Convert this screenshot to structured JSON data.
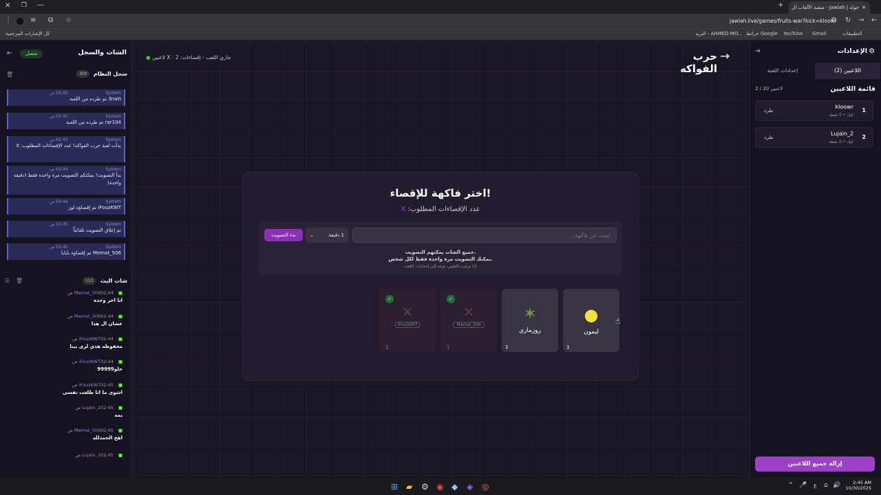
{
  "browser": {
    "tab_title": "جولة | Jawlah - منصة الألعاب ال",
    "url": "jawlah.live/games/fruits-war?kick=kloowr",
    "bookmarks": [
      "التطبيقات",
      "Gmail",
      "YouTube",
      "خرائط Google",
      "البريد - AHMED MO...",
      "كل الإشارات المرجعية"
    ]
  },
  "left_panel": {
    "title": "الشات والسجل",
    "status": "متصل",
    "log_title": "سجل النظام",
    "log_count": "300",
    "log": [
      {
        "who": "System",
        "time": "02:42 ص",
        "text": "3natt تم طرده من اللعبة"
      },
      {
        "who": "System",
        "time": "02:43 ص",
        "text": "rar104 تم طرده من اللعبة"
      },
      {
        "who": "System",
        "time": "02:43 ص",
        "text": "بدأت لعبة حرب الفواكه! عدد الإقصاءات المطلوب: X"
      },
      {
        "who": "System",
        "time": "02:44 ص",
        "text": "بدأ التصويت! يمكنكم التصويت مرة واحدة فقط (دقيقة واحدة)"
      },
      {
        "who": "System",
        "time": "02:44 ص",
        "text": "iFouzKWT تم إقصاؤه لوز"
      },
      {
        "who": "System",
        "time": "02:45 ص",
        "text": "تم إغلاق التصويت تلقائياً"
      },
      {
        "who": "System",
        "time": "02:45 ص",
        "text": "Memat_506 تم إقصاؤه بابايا"
      }
    ],
    "chat_title": "شات البث",
    "chat_count": "113",
    "chat": [
      {
        "who": "Memat_506",
        "time": "02:44 ص",
        "text": "انا اخر وحده"
      },
      {
        "who": "Memat_506",
        "time": "02:44 ص",
        "text": "عشان ال هذا"
      },
      {
        "who": "iFouzKWT",
        "time": "02:44 ص",
        "text": "محفوظه هذي لرى بينا"
      },
      {
        "who": "iFouzKWT",
        "time": "02:44 ص",
        "text": "حلو99999"
      },
      {
        "who": "iFouzKWT",
        "time": "02:45 ص",
        "text": "اشوى ما انا طلعت نفسي"
      },
      {
        "who": "Lujain_2",
        "time": "02:45 ص",
        "text": "يمه"
      },
      {
        "who": "Memat_506",
        "time": "02:45 ص",
        "text": "اهخ الحمدلله"
      },
      {
        "who": "Lujain_2",
        "time": "02:45 ص",
        "text": ""
      }
    ]
  },
  "header": {
    "title": "حرب الفواكه",
    "players_count": "2 لاعبين",
    "status": "جاري اللعب - إقصاءات: X"
  },
  "card": {
    "title": "اختر فاكهة للإقصاء!",
    "subtitle": "عدد الإقصاءات المطلوب:",
    "subtitle_value": "X",
    "search_placeholder": "ابحث عن فاكهة...",
    "duration": "1 دقيقة",
    "start_vote": "بدء التصويت",
    "info1": "جميع الشات يمكنهم التصويت.",
    "info2": "يمكنك التصويت مرة واحدة فقط لكل شخص.",
    "info3": "إذا ترغب بالتغيير، توجه إلى إعدادات اللعبة",
    "fruits": [
      {
        "name": "ليمون",
        "votes": "1",
        "eliminated": false,
        "by": ""
      },
      {
        "name": "روزماري",
        "votes": "1",
        "eliminated": false,
        "by": ""
      },
      {
        "name": "بابايا",
        "votes": "1",
        "eliminated": true,
        "by": "Memat_506"
      },
      {
        "name": "لوز",
        "votes": "1",
        "eliminated": true,
        "by": "iFouzKWT"
      }
    ]
  },
  "right_panel": {
    "title": "الإعدادات",
    "tab_players": "اللاعبين (2)",
    "tab_settings": "إعدادات اللعبة",
    "list_title": "قائمة اللاعبين",
    "list_count": "2 / 20 لاعبين",
    "players": [
      {
        "rank": "1",
        "name": "kloowr",
        "meta": "كيك • 0 نقطة",
        "kick": "طرد"
      },
      {
        "rank": "2",
        "name": "Lujain_2",
        "meta": "كيك • 0 نقطة",
        "kick": "طرد"
      }
    ],
    "remove_all": "إزالة جميع اللاعبين"
  },
  "taskbar": {
    "time": "2:45 AM",
    "date": "10/30/2025",
    "lang": "ع"
  },
  "colors": {
    "accent": "#9b3fc4",
    "kick_green": "#53fc18",
    "system": "#8a8fd6"
  }
}
